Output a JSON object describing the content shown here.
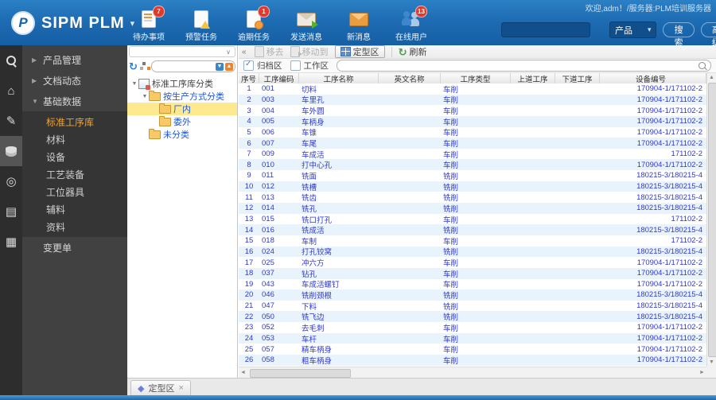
{
  "icons": {
    "double_left": "«",
    "panel_chevron": "∨",
    "refresh": "↻",
    "dropdown_caret": "▾",
    "up_arrow": "▲",
    "down_arrow": "▼",
    "left_arrow": "◄",
    "right_arrow": "►",
    "diamond": "◆",
    "close": "×"
  },
  "header": {
    "logo_text": "SIPM PLM",
    "logo_letter": "P",
    "welcome": "欢迎,adm！/服务器:PLM培训服务器",
    "tools": [
      {
        "name": "todo-items",
        "label": "待办事项",
        "badge": "7",
        "icon_class": "i-todo"
      },
      {
        "name": "warning-tasks",
        "label": "预警任务",
        "badge": "",
        "icon_class": "i-alert"
      },
      {
        "name": "overdue-tasks",
        "label": "逾期任务",
        "badge": "1",
        "icon_class": "i-notify"
      },
      {
        "name": "send-message",
        "label": "发送消息",
        "badge": "",
        "icon_class": "i-send"
      },
      {
        "name": "new-messages",
        "label": "新消息",
        "badge": "",
        "icon_class": "i-newmsg"
      },
      {
        "name": "online-users",
        "label": "在线用户",
        "badge": "13",
        "icon_class": "i-users"
      }
    ],
    "search": {
      "value": "",
      "category": "产品",
      "search_label": "搜索",
      "advanced_label": "高级"
    }
  },
  "icon_strip": [
    {
      "name": "sipm-search",
      "cls": "i-mag",
      "glyph": "",
      "active": false
    },
    {
      "name": "home",
      "cls": "",
      "glyph": "⌂",
      "active": false
    },
    {
      "name": "edit",
      "cls": "",
      "glyph": "✎",
      "active": false
    },
    {
      "name": "base-data",
      "cls": "i-dbx",
      "glyph": "",
      "active": true
    },
    {
      "name": "support",
      "cls": "",
      "glyph": "◎",
      "active": false
    },
    {
      "name": "library",
      "cls": "",
      "glyph": "▤",
      "active": false
    },
    {
      "name": "id-card",
      "cls": "",
      "glyph": "▦",
      "active": false
    }
  ],
  "sidebar": {
    "items": [
      {
        "name": "product-mgmt",
        "label": "产品管理",
        "arrow": "▶"
      },
      {
        "name": "doc-activity",
        "label": "文档动态",
        "arrow": "▶"
      },
      {
        "name": "base-data",
        "label": "基础数据",
        "arrow": "▼",
        "children": [
          {
            "name": "standard-process-lib",
            "label": "标准工序库",
            "active": true
          },
          {
            "name": "material",
            "label": "材料",
            "active": false
          },
          {
            "name": "equipment",
            "label": "设备",
            "active": false
          },
          {
            "name": "process-equipment",
            "label": "工艺装备",
            "active": false
          },
          {
            "name": "station-tools",
            "label": "工位器具",
            "active": false
          },
          {
            "name": "aux-material",
            "label": "辅料",
            "active": false
          },
          {
            "name": "documents",
            "label": "资料",
            "active": false
          }
        ]
      },
      {
        "name": "change-order",
        "label": "变更单",
        "arrow": ""
      }
    ]
  },
  "tree": {
    "nodes": [
      {
        "label": "标准工序库分类",
        "level": 0,
        "icon": "grid-ic",
        "expander": "▼",
        "selected": false,
        "root": true
      },
      {
        "label": "按生产方式分类",
        "level": 1,
        "icon": "folder",
        "expander": "▼",
        "selected": false,
        "root": false
      },
      {
        "label": "厂内",
        "level": 2,
        "icon": "folder",
        "expander": "",
        "selected": true,
        "root": false
      },
      {
        "label": "委外",
        "level": 2,
        "icon": "folder",
        "expander": "",
        "selected": false,
        "root": false
      },
      {
        "label": "未分类",
        "level": 1,
        "icon": "folder",
        "expander": "",
        "selected": false,
        "root": false
      }
    ]
  },
  "main": {
    "toolbar": {
      "remove_label": "移去",
      "move_to_label": "移动到",
      "fixed_zone_label": "定型区",
      "refresh_label": "刷新"
    },
    "filters": {
      "archive_label": "归档区",
      "archive_checked": true,
      "work_label": "工作区",
      "work_checked": false,
      "search_value": ""
    },
    "table": {
      "columns": [
        "序号",
        "工序编码",
        "工序名称",
        "英文名称",
        "工序类型",
        "上道工序",
        "下道工序",
        "设备编号"
      ],
      "rows": [
        [
          "1",
          "001",
          "切料",
          "",
          "车削",
          "",
          "",
          "170904-1/171102-2"
        ],
        [
          "2",
          "003",
          "车里孔",
          "",
          "车削",
          "",
          "",
          "170904-1/171102-2"
        ],
        [
          "3",
          "004",
          "车外圆",
          "",
          "车削",
          "",
          "",
          "170904-1/171102-2"
        ],
        [
          "4",
          "005",
          "车柄身",
          "",
          "车削",
          "",
          "",
          "170904-1/171102-2"
        ],
        [
          "5",
          "006",
          "车锥",
          "",
          "车削",
          "",
          "",
          "170904-1/171102-2"
        ],
        [
          "6",
          "007",
          "车尾",
          "",
          "车削",
          "",
          "",
          "170904-1/171102-2"
        ],
        [
          "7",
          "009",
          "车成活",
          "",
          "车削",
          "",
          "",
          "171102-2"
        ],
        [
          "8",
          "010",
          "打中心孔",
          "",
          "车削",
          "",
          "",
          "170904-1/171102-2"
        ],
        [
          "9",
          "011",
          "铣面",
          "",
          "铣削",
          "",
          "",
          "180215-3/180215-4"
        ],
        [
          "10",
          "012",
          "铣槽",
          "",
          "铣削",
          "",
          "",
          "180215-3/180215-4"
        ],
        [
          "11",
          "013",
          "铣齿",
          "",
          "铣削",
          "",
          "",
          "180215-3/180215-4"
        ],
        [
          "12",
          "014",
          "铣孔",
          "",
          "铣削",
          "",
          "",
          "180215-3/180215-4"
        ],
        [
          "13",
          "015",
          "铣口打孔",
          "",
          "车削",
          "",
          "",
          "171102-2"
        ],
        [
          "14",
          "016",
          "铣成活",
          "",
          "铣削",
          "",
          "",
          "180215-3/180215-4"
        ],
        [
          "15",
          "018",
          "车制",
          "",
          "车削",
          "",
          "",
          "171102-2"
        ],
        [
          "16",
          "024",
          "打孔铰窝",
          "",
          "铣削",
          "",
          "",
          "180215-3/180215-4"
        ],
        [
          "17",
          "025",
          "冲六方",
          "",
          "车削",
          "",
          "",
          "170904-1/171102-2"
        ],
        [
          "18",
          "037",
          "钻孔",
          "",
          "车削",
          "",
          "",
          "170904-1/171102-2"
        ],
        [
          "19",
          "043",
          "车成活螺钉",
          "",
          "车削",
          "",
          "",
          "170904-1/171102-2"
        ],
        [
          "20",
          "046",
          "铣削颈根",
          "",
          "铣削",
          "",
          "",
          "180215-3/180215-4"
        ],
        [
          "21",
          "047",
          "下料",
          "",
          "铣削",
          "",
          "",
          "180215-3/180215-4"
        ],
        [
          "22",
          "050",
          "铣飞边",
          "",
          "铣削",
          "",
          "",
          "180215-3/180215-4"
        ],
        [
          "23",
          "052",
          "去毛刺",
          "",
          "车削",
          "",
          "",
          "170904-1/171102-2"
        ],
        [
          "24",
          "053",
          "车杆",
          "",
          "车削",
          "",
          "",
          "170904-1/171102-2"
        ],
        [
          "25",
          "057",
          "精车柄身",
          "",
          "车削",
          "",
          "",
          "170904-1/171102-2"
        ],
        [
          "26",
          "058",
          "粗车柄身",
          "",
          "车削",
          "",
          "",
          "170904-1/171102-2"
        ]
      ]
    }
  },
  "bottom": {
    "tab_label": "定型区"
  }
}
